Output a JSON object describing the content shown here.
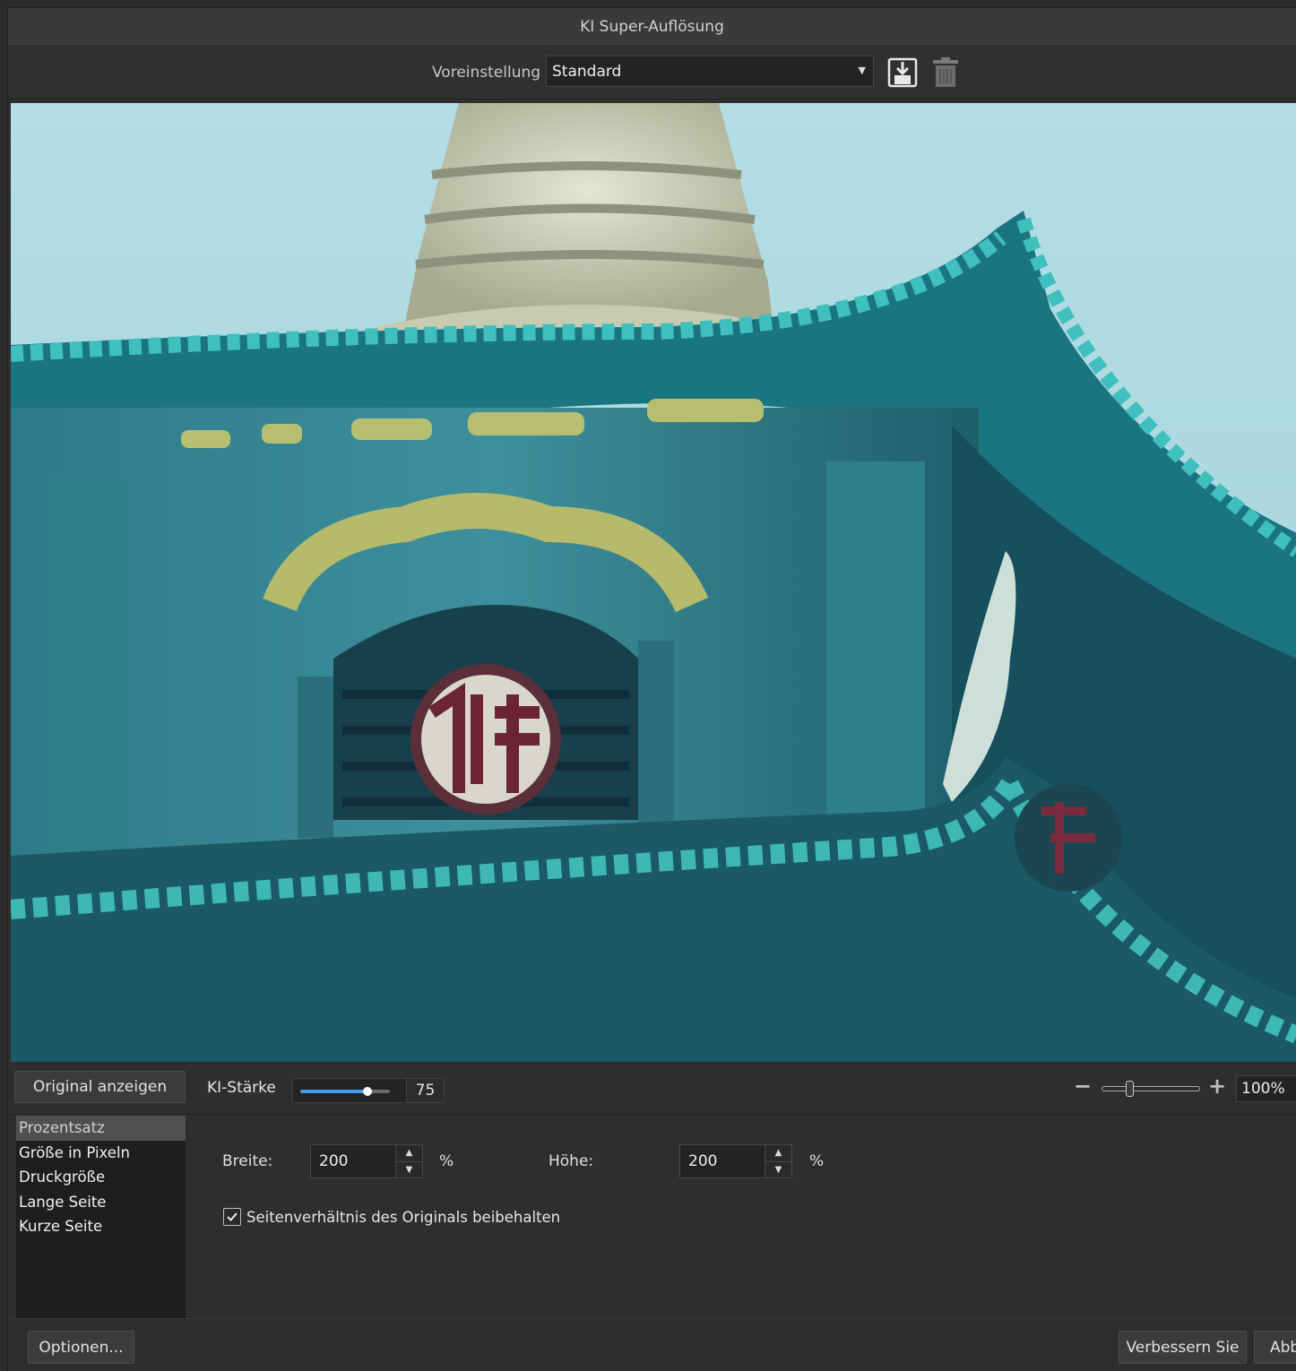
{
  "window": {
    "title": "KI Super-Auflösung"
  },
  "toolbar": {
    "preset_label": "Voreinstellung",
    "preset_value": "Standard",
    "save_icon": "save-preset-icon",
    "delete_icon": "trash-icon"
  },
  "preview": {
    "subject": "Pagoda roof photo preview"
  },
  "controls": {
    "show_original_label": "Original anzeigen",
    "ki_strength_label": "KI-Stärke",
    "ki_strength_value": "75",
    "ki_strength_fraction": 0.75,
    "zoom_value": "100%",
    "zoom_minus": "−",
    "zoom_plus": "+"
  },
  "modes": {
    "items": [
      {
        "label": "Prozentsatz",
        "selected": true
      },
      {
        "label": "Größe in Pixeln",
        "selected": false
      },
      {
        "label": "Druckgröße",
        "selected": false
      },
      {
        "label": "Lange Seite",
        "selected": false
      },
      {
        "label": "Kurze Seite",
        "selected": false
      }
    ]
  },
  "size": {
    "width_label": "Breite:",
    "width_value": "200",
    "height_label": "Höhe:",
    "height_value": "200",
    "unit": "%",
    "keep_ratio_label": "Seitenverhältnis des Originals beibehalten",
    "keep_ratio_checked": true
  },
  "footer": {
    "options_label": "Optionen...",
    "enhance_label": "Verbessern Sie",
    "cancel_label": "Abb"
  },
  "colors": {
    "accent": "#3f9df0",
    "sky": "#a9d6df",
    "roof": "#1f7f86"
  }
}
